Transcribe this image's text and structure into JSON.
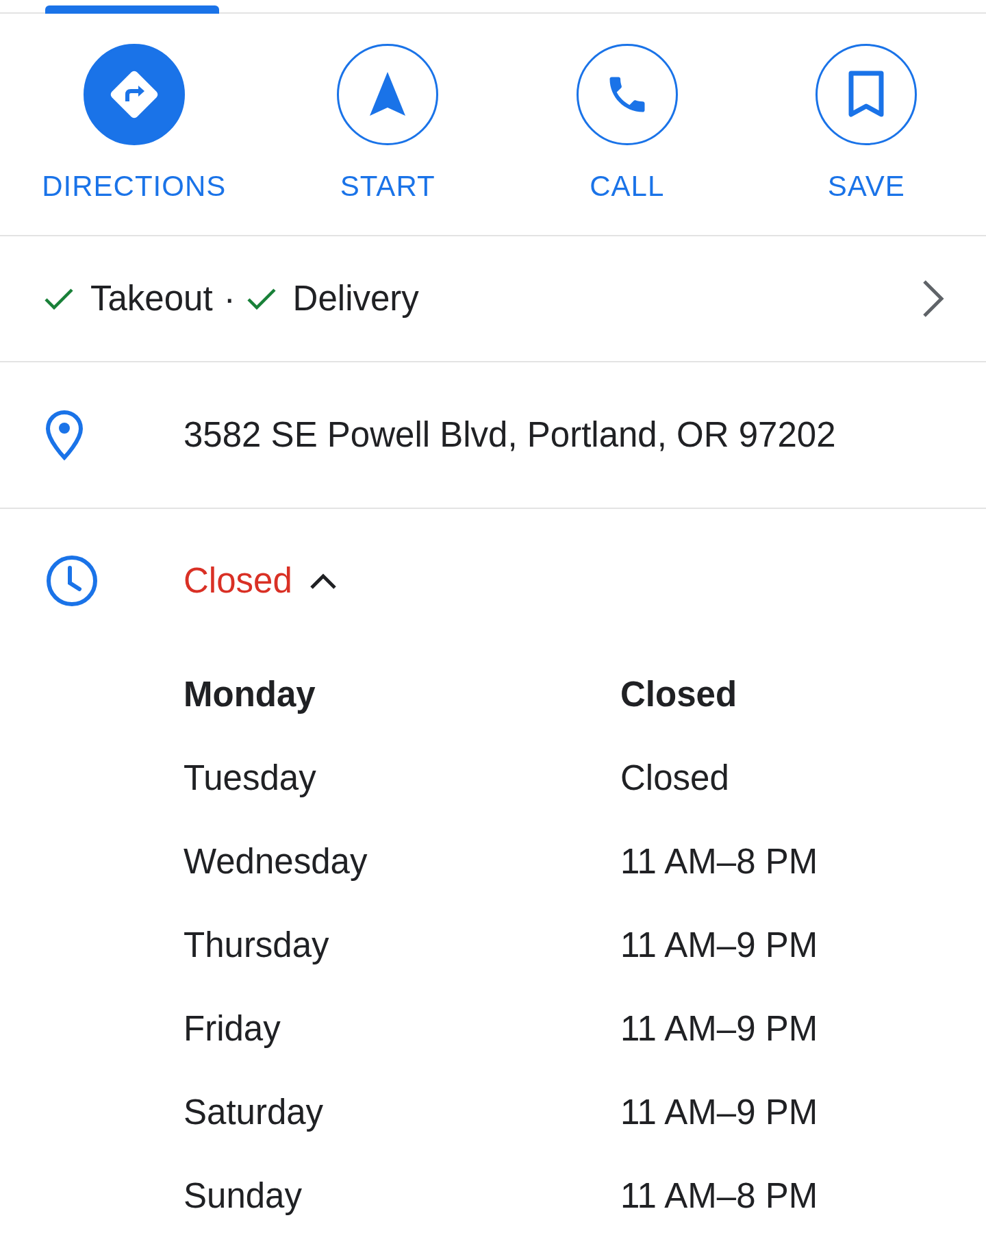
{
  "actions": [
    {
      "label": "DIRECTIONS",
      "kind": "directions",
      "filled": true
    },
    {
      "label": "START",
      "kind": "start",
      "filled": false
    },
    {
      "label": "CALL",
      "kind": "call",
      "filled": false
    },
    {
      "label": "SAVE",
      "kind": "save",
      "filled": false
    }
  ],
  "services": {
    "items": [
      {
        "label": "Takeout",
        "available": true
      },
      {
        "label": "Delivery",
        "available": true
      }
    ],
    "separator": "·"
  },
  "address": "3582 SE Powell Blvd, Portland, OR 97202",
  "hours": {
    "status": "Closed",
    "expanded": true,
    "days": [
      {
        "day": "Monday",
        "hours": "Closed",
        "today": true
      },
      {
        "day": "Tuesday",
        "hours": "Closed",
        "today": false
      },
      {
        "day": "Wednesday",
        "hours": "11 AM–8 PM",
        "today": false
      },
      {
        "day": "Thursday",
        "hours": "11 AM–9 PM",
        "today": false
      },
      {
        "day": "Friday",
        "hours": "11 AM–9 PM",
        "today": false
      },
      {
        "day": "Saturday",
        "hours": "11 AM–9 PM",
        "today": false
      },
      {
        "day": "Sunday",
        "hours": "11 AM–8 PM",
        "today": false
      }
    ]
  }
}
